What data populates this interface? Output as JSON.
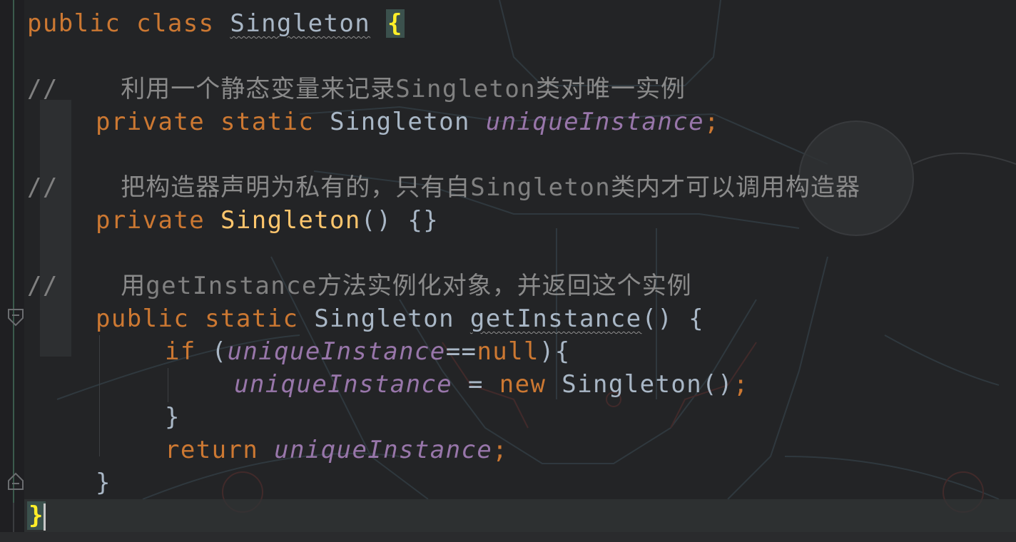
{
  "colors": {
    "background": "#232426",
    "keyword": "#cc7832",
    "identifier": "#a9b7c6",
    "field": "#9876aa",
    "method_decl": "#ffc66d",
    "comment": "#808080",
    "brace_match": "#ffef28"
  },
  "lines": {
    "l1": {
      "public": "public",
      "class": "class",
      "name": "Singleton",
      "brace": "{"
    },
    "c1": {
      "slash": "//",
      "text_a": "利用一个静态变量来记录",
      "text_b": "Singleton",
      "text_c": "类对唯一实例"
    },
    "l2": {
      "private": "private",
      "static": "static",
      "type": "Singleton",
      "field": "uniqueInstance",
      "semi": ";"
    },
    "c2": {
      "slash": "//",
      "text_a": "把构造器声明为私有的，只有自",
      "text_b": "Singleton",
      "text_c": "类内才可以调用构造器"
    },
    "l3": {
      "private": "private",
      "name": "Singleton",
      "rest": "() {}"
    },
    "c3": {
      "slash": "//",
      "text_a": "用",
      "text_b": "getInstance",
      "text_c": "方法实例化对象，并返回这个实例"
    },
    "l4": {
      "public": "public",
      "static": "static",
      "type": "Singleton",
      "method": "getInstance",
      "rest": "() {"
    },
    "l5": {
      "if": "if",
      "open": "(",
      "field": "uniqueInstance",
      "eq": "==",
      "null": "null",
      "close": "){"
    },
    "l6": {
      "field": "uniqueInstance",
      "assign": " = ",
      "new": "new",
      "ctor": "Singleton()",
      "semi": ";"
    },
    "l7": {
      "brace": "}"
    },
    "l8": {
      "return": "return",
      "field": "uniqueInstance",
      "semi": ";"
    },
    "l9": {
      "brace": "}"
    },
    "l10": {
      "brace": "}"
    }
  }
}
